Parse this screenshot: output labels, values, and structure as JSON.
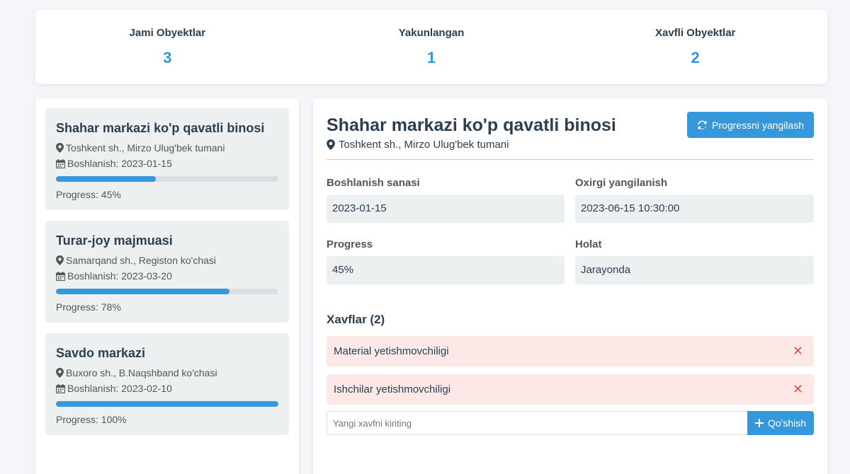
{
  "stats": [
    {
      "label": "Jami Obyektlar",
      "value": "3"
    },
    {
      "label": "Yakunlangan",
      "value": "1"
    },
    {
      "label": "Xavfli Obyektlar",
      "value": "2"
    }
  ],
  "projects": [
    {
      "name": "Shahar markazi ko'p qavatli binosi",
      "location": "Toshkent sh., Mirzo Ulug'bek tumani",
      "start": "Boshlanish: 2023-01-15",
      "progress": 45,
      "progress_text": "Progress: 45%"
    },
    {
      "name": "Turar-joy majmuasi",
      "location": "Samarqand sh., Registon ko'chasi",
      "start": "Boshlanish: 2023-03-20",
      "progress": 78,
      "progress_text": "Progress: 78%"
    },
    {
      "name": "Savdo markazi",
      "location": "Buxoro sh., B.Naqshband ko'chasi",
      "start": "Boshlanish: 2023-02-10",
      "progress": 100,
      "progress_text": "Progress: 100%"
    }
  ],
  "detail": {
    "title": "Shahar markazi ko'p qavatli binosi",
    "location": "Toshkent sh., Mirzo Ulug'bek tumani",
    "refresh_label": "Progressni yangilash",
    "fields": {
      "start_label": "Boshlanish sanasi",
      "start_value": "2023-01-15",
      "updated_label": "Oxirgi yangilanish",
      "updated_value": "2023-06-15 10:30:00",
      "progress_label": "Progress",
      "progress_value": "45%",
      "status_label": "Holat",
      "status_value": "Jarayonda"
    },
    "risks_title": "Xavflar (2)",
    "risks": [
      "Material yetishmovchiligi",
      "Ishchilar yetishmovchiligi"
    ],
    "remove_glyph": "✕",
    "new_risk_placeholder": "Yangi xavfni kiriting",
    "add_label": "Qo'shish"
  },
  "colors": {
    "accent": "#3498db",
    "danger": "#e74c3c",
    "risk_bg": "#fde8e8"
  },
  "icons": {
    "location": "map-marker-icon",
    "calendar": "calendar-icon",
    "refresh": "refresh-icon",
    "add": "plus-icon",
    "remove": "close-icon"
  }
}
